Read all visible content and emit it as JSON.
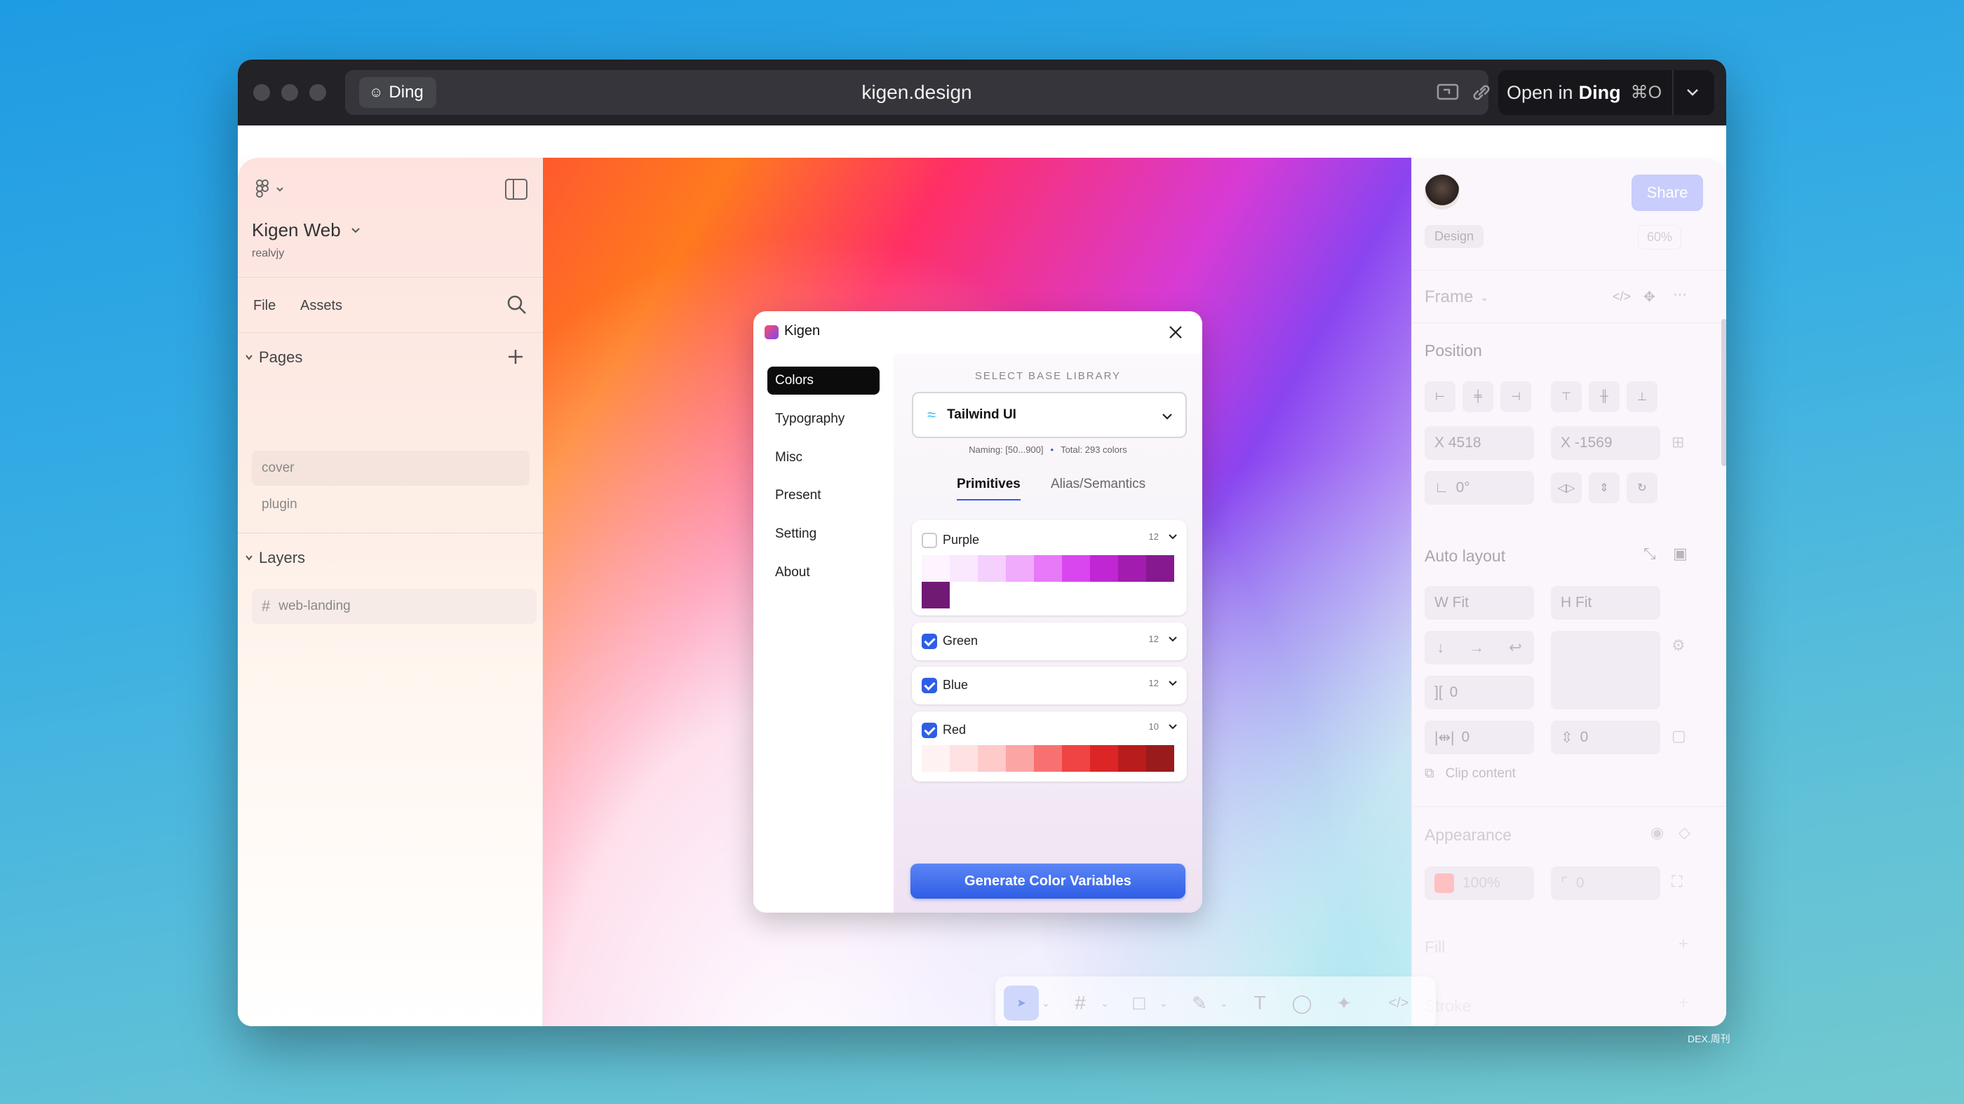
{
  "browser": {
    "chip_label": "Ding",
    "url": "kigen.design",
    "open_label": "Open in",
    "open_app": "Ding",
    "open_shortcut": "⌘O"
  },
  "left_panel": {
    "project_name": "Kigen Web",
    "owner": "realvjy",
    "tabs": [
      "File",
      "Assets"
    ],
    "pages_title": "Pages",
    "pages": [
      "cover",
      "plugin"
    ],
    "layers_title": "Layers",
    "layers": [
      "web-landing"
    ]
  },
  "right_panel": {
    "share_label": "Share",
    "design_tab": "Design",
    "zoom": "60%",
    "frame_label": "Frame",
    "position_title": "Position",
    "x_value": "X  4518",
    "y_value": "X  -1569",
    "rotation": "0°",
    "auto_layout_title": "Auto layout",
    "w_value": "W  Fit",
    "h_value": "H  Fit",
    "gap_value": "0",
    "pad_h": "0",
    "pad_v": "0",
    "clip_label": "Clip content",
    "appearance_title": "Appearance",
    "opacity": "100%",
    "radius": "0",
    "fill_title": "Fill",
    "stroke_title": "Stroke"
  },
  "plugin": {
    "title": "Kigen",
    "nav": [
      "Colors",
      "Typography",
      "Misc",
      "Present",
      "Setting",
      "About"
    ],
    "active_nav": "Colors",
    "section_label": "SELECT BASE LIBRARY",
    "library": "Tailwind UI",
    "naming": "Naming: [50...900]",
    "total": "Total: 293 colors",
    "tabs": [
      "Primitives",
      "Alias/Semantics"
    ],
    "active_tab": "Primitives",
    "groups": [
      {
        "name": "Purple",
        "count": "12",
        "checked": false,
        "expanded": true
      },
      {
        "name": "Green",
        "count": "12",
        "checked": true,
        "expanded": false
      },
      {
        "name": "Blue",
        "count": "12",
        "checked": true,
        "expanded": false
      },
      {
        "name": "Red",
        "count": "10",
        "checked": true,
        "expanded": true
      }
    ],
    "purple_swatches": [
      "#fdf4ff",
      "#fae8ff",
      "#f5d0fe",
      "#f0abfc",
      "#e879f9",
      "#d946ef",
      "#c026d3",
      "#a21caf",
      "#86198f",
      "#701a75"
    ],
    "red_swatches": [
      "#fef2f2",
      "#fee2e2",
      "#fecaca",
      "#fca5a5",
      "#f87171",
      "#ef4444",
      "#dc2626",
      "#b91c1c",
      "#991b1b"
    ],
    "generate_label": "Generate Color Variables"
  },
  "colors": {
    "accent": "#2f5ee6",
    "titlebar": "#222227"
  },
  "watermark": "DEX.周刊"
}
